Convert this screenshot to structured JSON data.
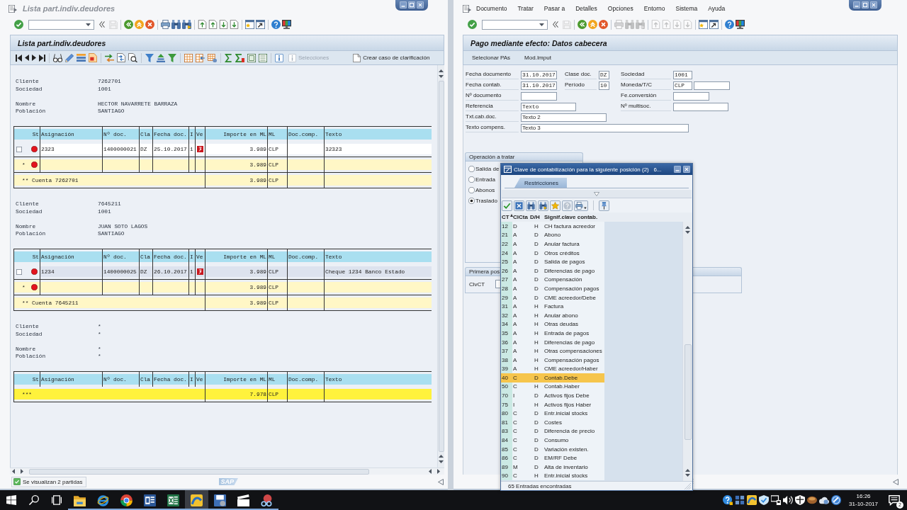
{
  "list_window": {
    "title": "Lista part.indiv.deudores",
    "toolbar": {
      "save_enabled": false,
      "list_actions_enabled": true
    },
    "panel_title": "Lista part.indiv.deudores",
    "app_toolbar": [
      {
        "label": "Selecciones",
        "disabled": true
      },
      {
        "label": "Crear caso de clarificación",
        "disabled": false
      }
    ],
    "blocks": [
      {
        "account": [
          {
            "label": "Cliente",
            "value": "7262701"
          },
          {
            "label": "Sociedad",
            "value": "1001"
          }
        ],
        "address": [
          {
            "label": "Nombre",
            "value": "HECTOR NAVARRETE BARRAZA"
          },
          {
            "label": "Población",
            "value": "SANTIAGO"
          }
        ],
        "columns": [
          "St",
          "Asignación",
          "Nº doc.",
          "Cla",
          "Fecha doc.",
          "I",
          "Ve",
          "Importe en ML",
          "ML",
          "Doc.comp.",
          "Texto"
        ],
        "rows": [
          {
            "kind": "item",
            "checked": false,
            "selected": false,
            "open": true,
            "overdue": true,
            "assignment": "2323",
            "doc_no": "1400000021",
            "doc_type": "DZ",
            "doc_date": "25.10.2017",
            "item": "1",
            "amount": "3.989",
            "currency": "CLP",
            "text": "32323"
          },
          {
            "kind": "subtotal",
            "marker": "*",
            "open": true,
            "amount": "3.989",
            "currency": "CLP"
          },
          {
            "kind": "total",
            "label": "** Cuenta 7262701",
            "amount": "3.989",
            "currency": "CLP"
          }
        ]
      },
      {
        "account": [
          {
            "label": "Cliente",
            "value": "7645211"
          },
          {
            "label": "Sociedad",
            "value": "1001"
          }
        ],
        "address": [
          {
            "label": "Nombre",
            "value": "JUAN SOTO LAGOS"
          },
          {
            "label": "Población",
            "value": "SANTIAGO"
          }
        ],
        "columns": [
          "St",
          "Asignación",
          "Nº doc.",
          "Cla",
          "Fecha doc.",
          "I",
          "Ve",
          "Importe en ML",
          "ML",
          "Doc.comp.",
          "Texto"
        ],
        "rows": [
          {
            "kind": "item",
            "checked": false,
            "selected": true,
            "open": true,
            "overdue": true,
            "assignment": "1234",
            "doc_no": "1400000025",
            "doc_type": "DZ",
            "doc_date": "26.10.2017",
            "item": "1",
            "amount": "3.989",
            "currency": "CLP",
            "text": "Cheque 1234 Banco Estado"
          },
          {
            "kind": "subtotal",
            "marker": "*",
            "open": true,
            "amount": "3.989",
            "currency": "CLP"
          },
          {
            "kind": "total",
            "label": "** Cuenta 7645211",
            "amount": "3.989",
            "currency": "CLP"
          }
        ]
      },
      {
        "account": [
          {
            "label": "Cliente",
            "value": "*"
          },
          {
            "label": "Sociedad",
            "value": "*"
          }
        ],
        "address": [
          {
            "label": "Nombre",
            "value": "*"
          },
          {
            "label": "Población",
            "value": "*"
          }
        ],
        "columns": [
          "St",
          "Asignación",
          "Nº doc.",
          "Cla",
          "Fecha doc.",
          "I",
          "Ve",
          "Importe en ML",
          "ML",
          "Doc.comp.",
          "Texto"
        ],
        "rows": [
          {
            "kind": "grand_total",
            "label": "***",
            "amount": "7.978",
            "currency": "CLP"
          }
        ]
      }
    ],
    "status_bar": {
      "success": true,
      "message": "Se visualizan 2 partidas",
      "logo": "SAP"
    }
  },
  "entry_window": {
    "menu": [
      "Documento",
      "Tratar",
      "Pasar a",
      "Detalles",
      "Opciones",
      "Entorno",
      "Sistema",
      "Ayuda"
    ],
    "toolbar": {
      "save_enabled": false,
      "list_actions_enabled": false
    },
    "panel_title": "Pago mediante efecto: Datos cabecera",
    "app_toolbar": [
      "Selecionar PAs",
      "Mod.Imput"
    ],
    "header_form": {
      "left": [
        {
          "label": "Fecha documento",
          "inputs": [
            {
              "kind": "date",
              "value": "31.10.2017"
            }
          ]
        },
        {
          "label": "Fecha contab.",
          "inputs": [
            {
              "kind": "date",
              "value": "31.10.2017"
            }
          ]
        },
        {
          "label": "Nº documento",
          "inputs": [
            {
              "kind": "number"
            }
          ]
        },
        {
          "label": "Referencia",
          "inputs": [
            {
              "kind": "reference",
              "value": "Texto"
            }
          ]
        },
        {
          "label": "Txt.cab.doc.",
          "inputs": [
            {
              "kind": "header_text",
              "value": "Texto 2"
            }
          ]
        },
        {
          "label": "Texto compens.",
          "inputs": [
            {
              "kind": "clearing_text",
              "value": "Texto 3"
            }
          ]
        }
      ],
      "middle": [
        {
          "label": "Clase doc.",
          "inputs": [
            {
              "kind": "key",
              "value": "DZ"
            }
          ]
        },
        {
          "label": "Período",
          "inputs": [
            {
              "kind": "key",
              "value": "10"
            }
          ]
        }
      ],
      "right": [
        {
          "label": "Sociedad",
          "inputs": [
            {
              "kind": "code",
              "value": "1001"
            }
          ]
        },
        {
          "label": "Moneda/T/C",
          "inputs": [
            {
              "kind": "code",
              "value": "CLP"
            },
            {
              "kind": "rate"
            }
          ]
        },
        {
          "label": "Fe.conversión",
          "inputs": [
            {
              "kind": "date"
            }
          ]
        },
        {
          "label": "Nº multisoc.",
          "inputs": [
            {
              "kind": "reference"
            }
          ]
        }
      ]
    },
    "operation_group": {
      "title": "Operación a tratar",
      "options": [
        {
          "label": "Salida de",
          "selected": false
        },
        {
          "label": "Entrada",
          "selected": false
        },
        {
          "label": "Abonos",
          "selected": false
        },
        {
          "label": "Traslado",
          "selected": true
        }
      ]
    },
    "first_item_group": {
      "title": "Primera pos",
      "fields": [
        {
          "label": "ClvCT"
        }
      ]
    }
  },
  "dialog": {
    "title": "Clave de contabilización para la siguiente posición (2)   6...",
    "tabs": [
      {
        "label": "Restricciones",
        "selected": true
      }
    ],
    "columns": [
      {
        "label": "CT",
        "sorted": true
      },
      {
        "label": "ClCta",
        "sorted": false
      },
      {
        "label": "D/H",
        "sorted": false
      },
      {
        "label": "Signif.clave contab.",
        "sorted": false
      }
    ],
    "rows": [
      {
        "cells": [
          "12",
          "D",
          "H",
          "CH factura acreedor"
        ],
        "selected": false
      },
      {
        "cells": [
          "21",
          "A",
          "D",
          "Abono"
        ],
        "selected": false
      },
      {
        "cells": [
          "22",
          "A",
          "D",
          "Anular factura"
        ],
        "selected": false
      },
      {
        "cells": [
          "24",
          "A",
          "D",
          "Otros créditos"
        ],
        "selected": false
      },
      {
        "cells": [
          "25",
          "A",
          "D",
          "Salida de pagos"
        ],
        "selected": false
      },
      {
        "cells": [
          "26",
          "A",
          "D",
          "Diferencias de pago"
        ],
        "selected": false
      },
      {
        "cells": [
          "27",
          "A",
          "D",
          "Compensación"
        ],
        "selected": false
      },
      {
        "cells": [
          "28",
          "A",
          "D",
          "Compensación pagos"
        ],
        "selected": false
      },
      {
        "cells": [
          "29",
          "A",
          "D",
          "CME acreedor/Debe"
        ],
        "selected": false
      },
      {
        "cells": [
          "31",
          "A",
          "H",
          "Factura"
        ],
        "selected": false
      },
      {
        "cells": [
          "32",
          "A",
          "H",
          "Anular abono"
        ],
        "selected": false
      },
      {
        "cells": [
          "34",
          "A",
          "H",
          "Otras deudas"
        ],
        "selected": false
      },
      {
        "cells": [
          "35",
          "A",
          "H",
          "Entrada de pagos"
        ],
        "selected": false
      },
      {
        "cells": [
          "36",
          "A",
          "H",
          "Diferencias de pago"
        ],
        "selected": false
      },
      {
        "cells": [
          "37",
          "A",
          "H",
          "Otras compensaciones"
        ],
        "selected": false
      },
      {
        "cells": [
          "38",
          "A",
          "H",
          "Compensación pagos"
        ],
        "selected": false
      },
      {
        "cells": [
          "39",
          "A",
          "H",
          "CME acreedor/Haber"
        ],
        "selected": false
      },
      {
        "cells": [
          "40",
          "C",
          "D",
          "Contab.Debe"
        ],
        "selected": true
      },
      {
        "cells": [
          "50",
          "C",
          "H",
          "Contab.Haber"
        ],
        "selected": false
      },
      {
        "cells": [
          "70",
          "I",
          "D",
          "Activos fijos Debe"
        ],
        "selected": false
      },
      {
        "cells": [
          "75",
          "I",
          "H",
          "Activos fijos Haber"
        ],
        "selected": false
      },
      {
        "cells": [
          "80",
          "C",
          "D",
          "Entr.inicial stocks"
        ],
        "selected": false
      },
      {
        "cells": [
          "81",
          "C",
          "D",
          "Costes"
        ],
        "selected": false
      },
      {
        "cells": [
          "83",
          "C",
          "D",
          "Diferencia de precio"
        ],
        "selected": false
      },
      {
        "cells": [
          "84",
          "C",
          "D",
          "Consumo"
        ],
        "selected": false
      },
      {
        "cells": [
          "85",
          "C",
          "D",
          "Variación existen."
        ],
        "selected": false
      },
      {
        "cells": [
          "86",
          "C",
          "D",
          "EM/RF Debe"
        ],
        "selected": false
      },
      {
        "cells": [
          "89",
          "M",
          "D",
          "Alta de inventario"
        ],
        "selected": false
      },
      {
        "cells": [
          "90",
          "C",
          "H",
          "Entr.inicial stocks"
        ],
        "selected": false
      }
    ],
    "status": "65 Entradas encontradas"
  },
  "taskbar": {
    "apps": [
      {
        "open": true,
        "selected": false
      },
      {
        "open": true,
        "selected": false
      },
      {
        "open": true,
        "selected": false
      },
      {
        "open": true,
        "selected": false
      },
      {
        "open": true,
        "selected": false
      },
      {
        "open": true,
        "selected": true
      },
      {
        "open": true,
        "selected": false
      },
      {
        "open": true,
        "selected": false
      },
      {
        "open": true,
        "selected": false
      }
    ],
    "time": "16:26",
    "date": "31-10-2017",
    "notifications": "2"
  }
}
